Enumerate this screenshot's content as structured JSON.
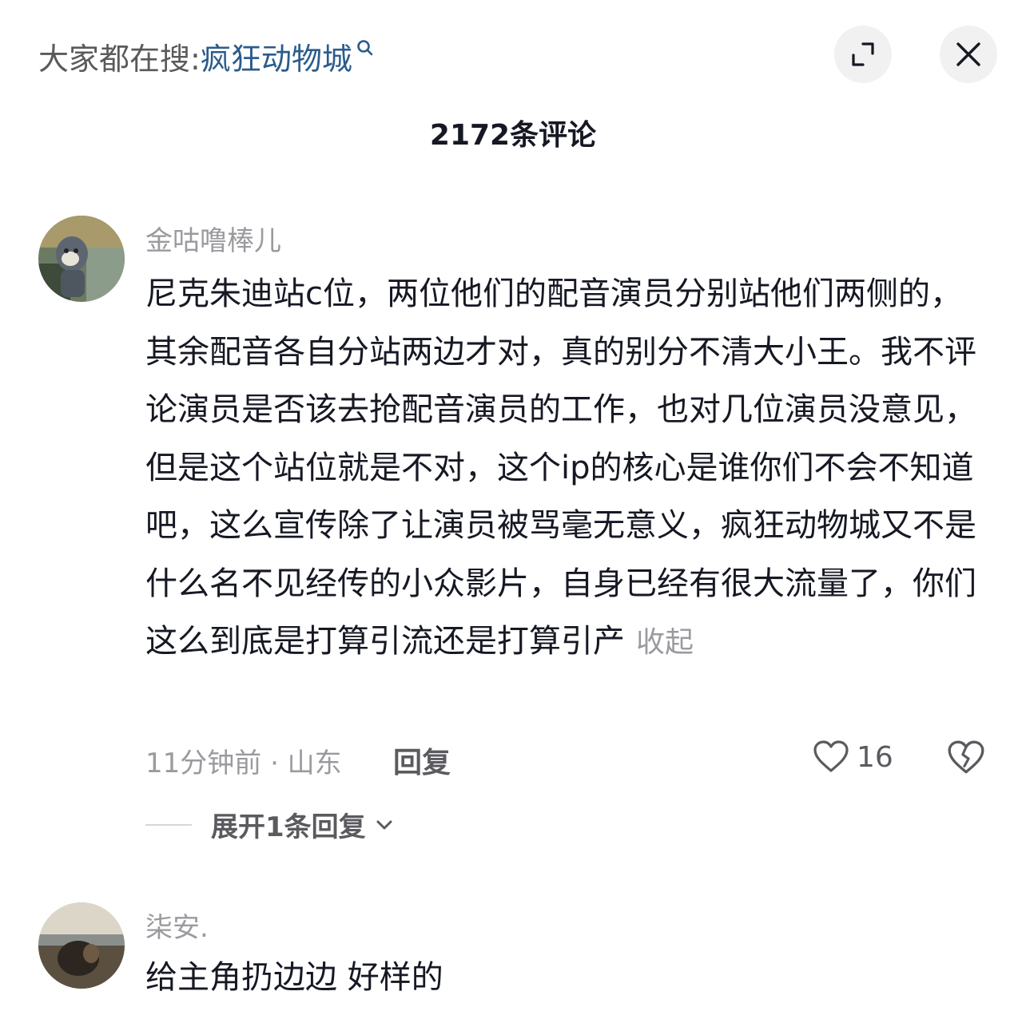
{
  "search": {
    "prefix": "大家都在搜:",
    "keyword": "疯狂动物城"
  },
  "header": {
    "comment_count": "2172条评论"
  },
  "comments": [
    {
      "username": "金咕噜棒儿",
      "text": "尼克朱迪站c位，两位他们的配音演员分别站他们两侧的，其余配音各自分站两边才对，真的别分不清大小王。我不评论演员是否该去抢配音演员的工作，也对几位演员没意见，但是这个站位就是不对，这个ip的核心是谁你们不会不知道吧，这么宣传除了让演员被骂毫无意义，疯狂动物城又不是什么名不见经传的小众影片，自身已经有很大流量了，你们这么到底是打算引流还是打算引产",
      "collapse_label": "收起",
      "time_location": "11分钟前 · 山东",
      "reply_label": "回复",
      "likes": "16",
      "expand_replies_label": "展开1条回复"
    },
    {
      "username": "柒安.",
      "text": "给主角扔边边 好样的"
    }
  ],
  "colors": {
    "keyword": "#2a5c8c",
    "muted": "#9a9a9f",
    "text": "#161823"
  }
}
